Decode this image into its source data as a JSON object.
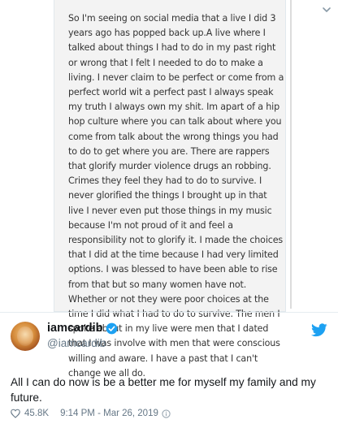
{
  "note": {
    "text": "So I'm seeing on social media that a live I did 3 years ago has popped back up.A live where I talked about things I had to do in my past right or wrong that I felt I needed to do to make a living. I never claim to be perfect or come from a perfect world wit a perfect past I always speak my truth I always own my shit. Im apart of a hip hop culture where you can talk about where you come from talk about the wrong things you had to do to get where you are. There are rappers that glorify murder violence drugs an robbing. Crimes they feel they had to do to survive. I never glorified the things I brought up in that live I never even put those things in my music because I'm not proud of it and feel a responsibility not to glorify it. I made the choices that I did at the time because I had very limited options. I was blessed to have been able to rise from that but so many women have not. Whether or not they were poor choices at the time I did what I had to do to survive. The men I spoke about in my live were men that I dated that I was involve with men that were conscious willing and aware. I have a past that I can't change we all do."
  },
  "author": {
    "display_name": "iamcardib",
    "handle": "@iamcardib",
    "verified": true
  },
  "tweet": {
    "text": "All I can do now is be a better me for myself my family and my future.",
    "likes": "45.8K",
    "time": "9:14 PM - Mar 26, 2019"
  },
  "icons": {
    "menu": "chevron-down-icon",
    "verified": "verified-badge-icon",
    "brand": "twitter-bird-icon",
    "like": "heart-icon"
  },
  "colors": {
    "brand": "#1da1f2",
    "verified": "#1da1f2",
    "text": "#14171a",
    "muted": "#657786",
    "note_bg": "#f3f3f3"
  }
}
